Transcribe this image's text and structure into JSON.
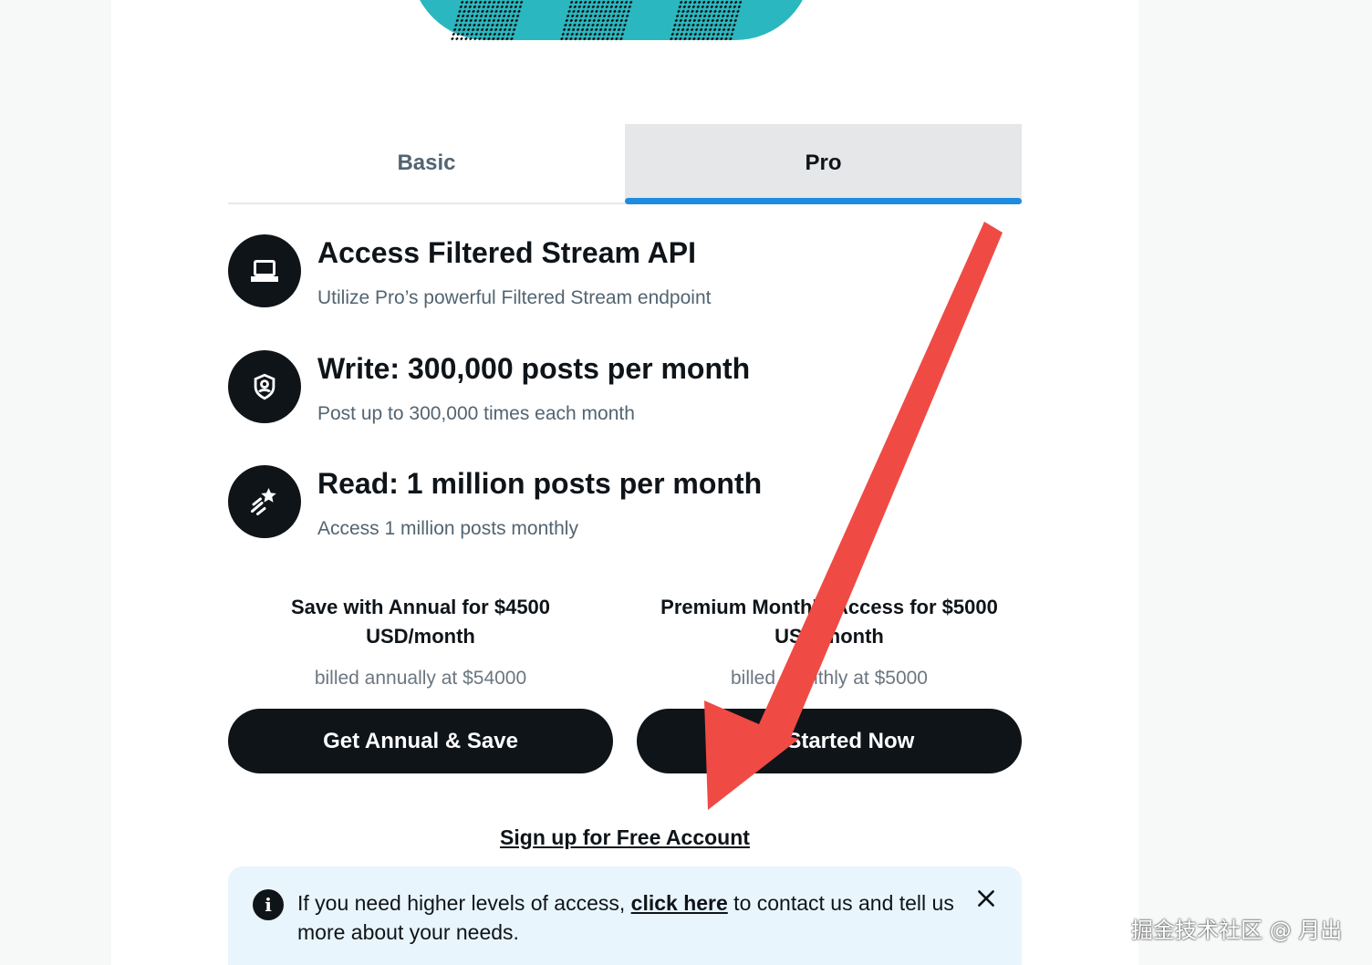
{
  "tabs": [
    {
      "label": "Basic",
      "active": false
    },
    {
      "label": "Pro",
      "active": true
    }
  ],
  "features": [
    {
      "icon": "laptop-icon",
      "title": "Access Filtered Stream API",
      "subtitle": "Utilize Pro’s powerful Filtered Stream endpoint"
    },
    {
      "icon": "shield-user-icon",
      "title": "Write: 300,000 posts per month",
      "subtitle": "Post up to 300,000 times each month"
    },
    {
      "icon": "sparkle-star-icon",
      "title": "Read: 1 million posts per month",
      "subtitle": "Access 1 million posts monthly"
    }
  ],
  "plans": {
    "annual": {
      "title_line1": "Save with Annual for $4500",
      "title_line2": "USD/month",
      "billed": "billed annually at $54000",
      "button": "Get Annual & Save"
    },
    "monthly": {
      "title_line1": "Premium Monthly Access for $5000",
      "title_line2": "USD/month",
      "billed": "billed monthly at $5000",
      "button": "Get Started Now"
    }
  },
  "signup_link": "Sign up for Free Account",
  "notice": {
    "text_before": "If you need higher levels of access, ",
    "link": "click here",
    "text_after": " to contact us and tell us more about your needs."
  },
  "watermark": "掘金技术社区 @ 月出",
  "colors": {
    "accent": "#1d8ce0",
    "button_bg": "#0f1419",
    "notice_bg": "#e8f5fd",
    "arrow": "#f04a45"
  }
}
